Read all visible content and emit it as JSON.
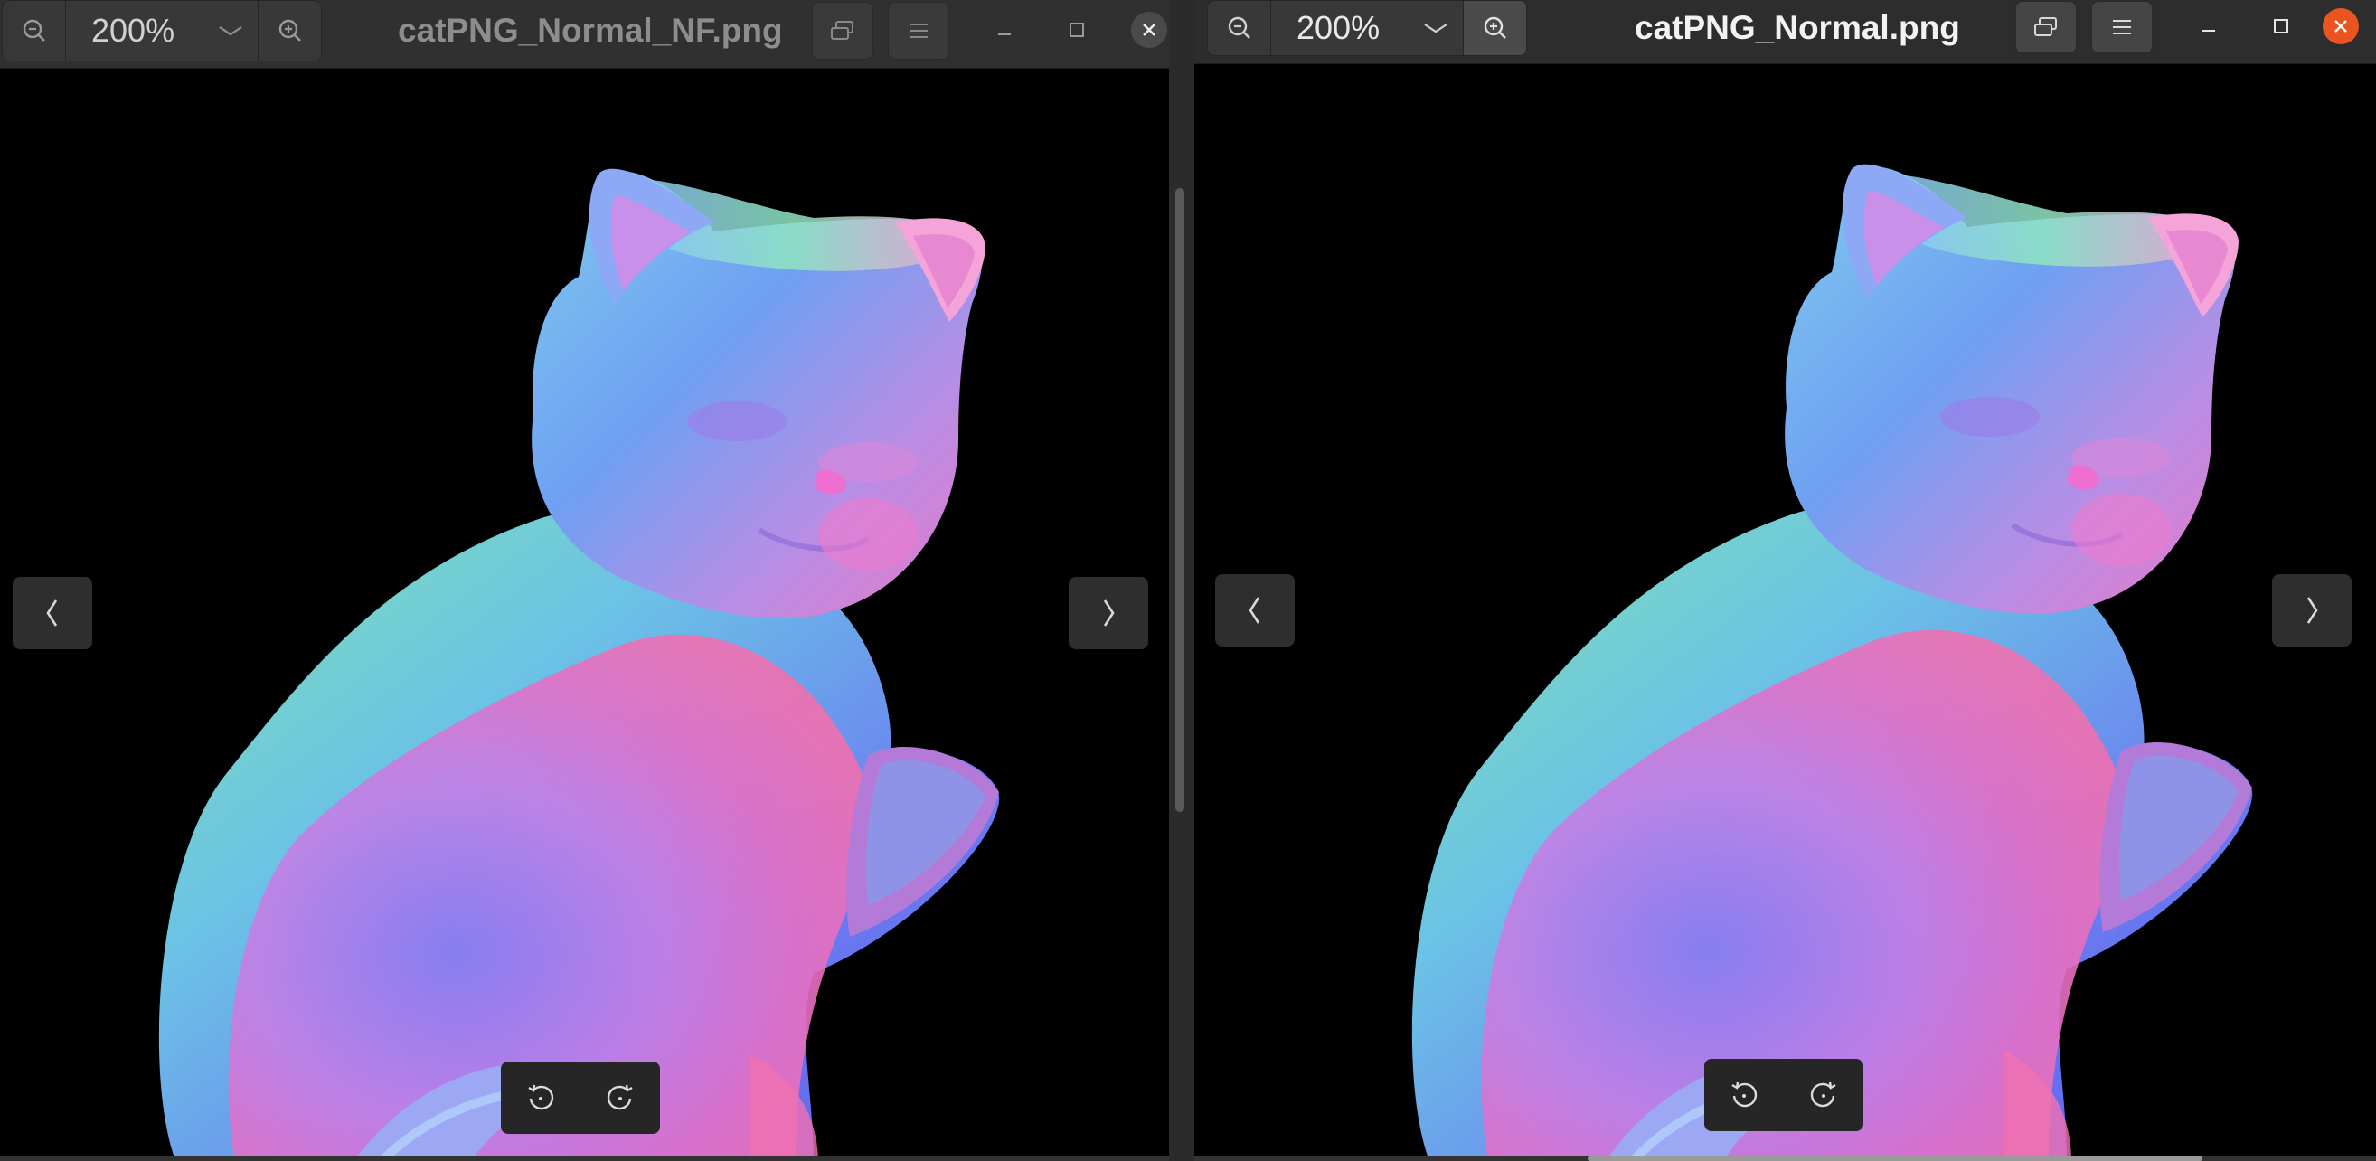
{
  "left_window": {
    "zoom_value": "200%",
    "title": "catPNG_Normal_NF.png",
    "icons": {
      "zoom_out": "zoom-out-icon",
      "zoom_dropdown": "chevron-down-icon",
      "zoom_in": "zoom-in-icon",
      "fullscreen": "fullscreen-icon",
      "menu": "hamburger-menu-icon",
      "minimize": "minimize-icon",
      "maximize": "maximize-icon",
      "close": "close-icon",
      "previous": "chevron-left-icon",
      "next": "chevron-right-icon",
      "rotate_left": "rotate-left-icon",
      "rotate_right": "rotate-right-icon"
    },
    "close_color": "#4a4a4a"
  },
  "right_window": {
    "zoom_value": "200%",
    "title": "catPNG_Normal.png",
    "icons": {
      "zoom_out": "zoom-out-icon",
      "zoom_dropdown": "chevron-down-icon",
      "zoom_in": "zoom-in-icon",
      "fullscreen": "fullscreen-icon",
      "menu": "hamburger-menu-icon",
      "minimize": "minimize-icon",
      "maximize": "maximize-icon",
      "close": "close-icon",
      "previous": "chevron-left-icon",
      "next": "chevron-right-icon",
      "rotate_left": "rotate-left-icon",
      "rotate_right": "rotate-right-icon"
    },
    "close_color": "#e95420"
  },
  "image_content": "normal-map-cat",
  "colors": {
    "accent_close": "#e95420",
    "headerbar": "#303030",
    "canvas": "#000000"
  }
}
